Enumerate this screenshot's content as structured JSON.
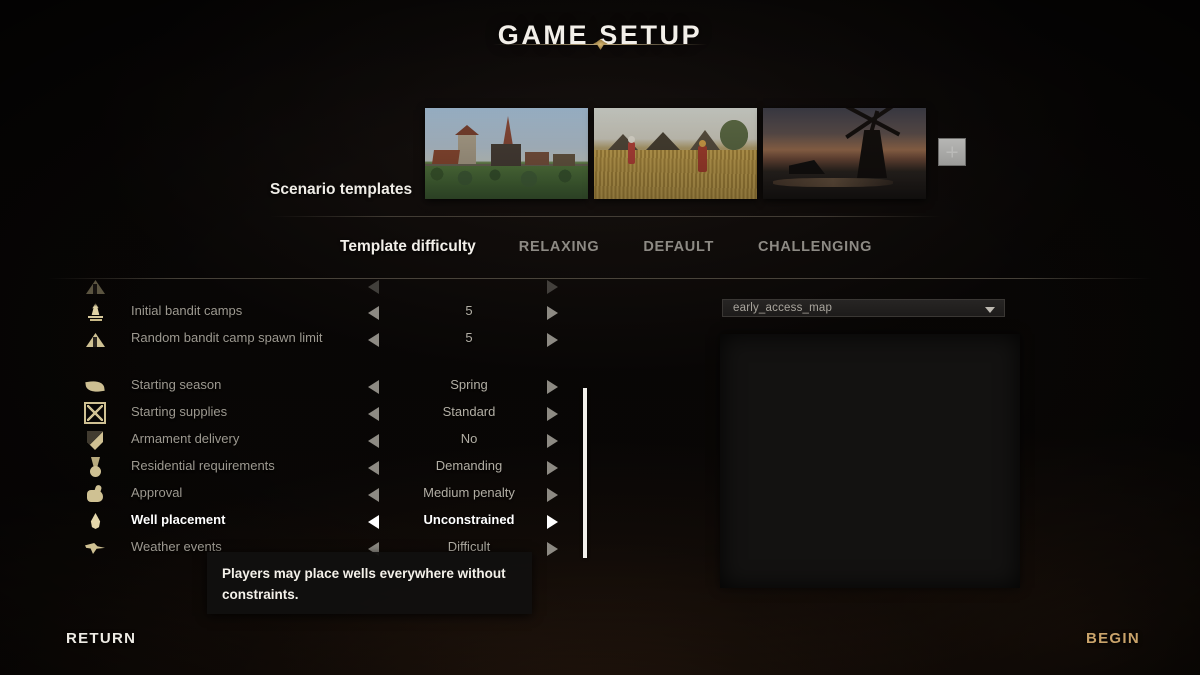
{
  "header": {
    "title": "GAME SETUP"
  },
  "templates": {
    "label": "Scenario templates",
    "items": [
      {
        "name": "village-scenario-thumbnail"
      },
      {
        "name": "farmland-scenario-thumbnail"
      },
      {
        "name": "windmill-scenario-thumbnail"
      }
    ],
    "add_button_icon": "plus-icon"
  },
  "difficulty": {
    "label": "Template difficulty",
    "options": [
      "RELAXING",
      "DEFAULT",
      "CHALLENGING"
    ]
  },
  "settings": {
    "rows": [
      {
        "icon": "campfire-icon",
        "label": "Initial bandit camps",
        "value": "5",
        "active": false
      },
      {
        "icon": "tent-icon",
        "label": "Random bandit camp spawn limit",
        "value": "5",
        "active": false
      },
      {
        "icon": "leaf-icon",
        "label": "Starting season",
        "value": "Spring",
        "active": false
      },
      {
        "icon": "crate-icon",
        "label": "Starting supplies",
        "value": "Standard",
        "active": false
      },
      {
        "icon": "shield-icon",
        "label": "Armament delivery",
        "value": "No",
        "active": false
      },
      {
        "icon": "medal-icon",
        "label": "Residential requirements",
        "value": "Demanding",
        "active": false
      },
      {
        "icon": "thumbs-up-icon",
        "label": "Approval",
        "value": "Medium penalty",
        "active": false
      },
      {
        "icon": "water-drop-icon",
        "label": "Well placement",
        "value": "Unconstrained",
        "active": true
      },
      {
        "icon": "weather-icon",
        "label": "Weather events",
        "value": "Difficult",
        "active": false
      }
    ]
  },
  "tooltip": {
    "text": "Players may place wells everywhere without constraints."
  },
  "map": {
    "selected": "early_access_map"
  },
  "footer": {
    "return_label": "RETURN",
    "begin_label": "BEGIN"
  },
  "colors": {
    "accent": "#c9a36a",
    "highlight": "#ffffff",
    "muted": "#9d9990"
  }
}
